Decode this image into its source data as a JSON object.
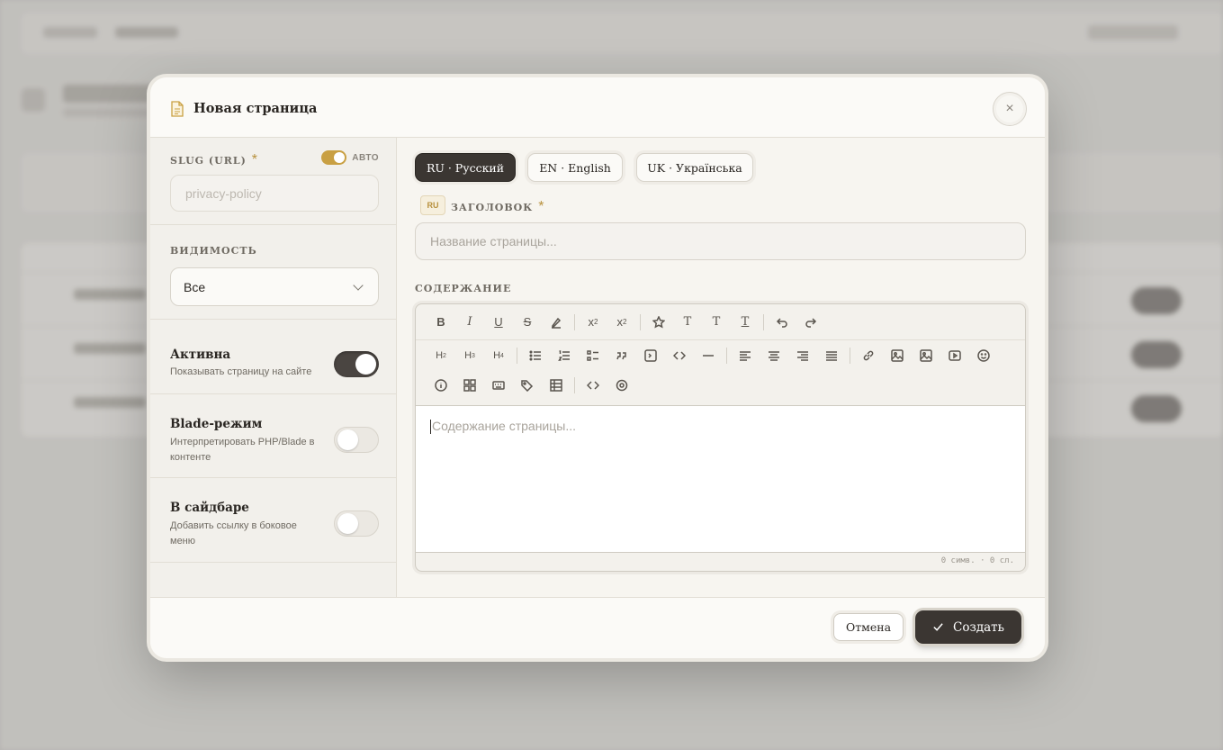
{
  "modal": {
    "title": "Новая страница",
    "close_icon": "×"
  },
  "sidebar": {
    "slug_label": "SLUG (URL)",
    "slug_required": "*",
    "auto_label": "АВТО",
    "slug_placeholder": "privacy-policy",
    "visibility_label": "ВИДИМОСТЬ",
    "visibility_value": "Все",
    "toggles": [
      {
        "title": "Активна",
        "desc": "Показывать страницу на сайте",
        "on": true
      },
      {
        "title": "Blade-режим",
        "desc": "Интерпретировать PHP/Blade в контенте",
        "on": false
      },
      {
        "title": "В сайдбаре",
        "desc": "Добавить ссылку в боковое меню",
        "on": false
      }
    ]
  },
  "main": {
    "lang_tabs": [
      "RU · Русский",
      "EN · English",
      "UK · Українська"
    ],
    "active_lang": "RU · Русский",
    "lang_badge": "RU",
    "title_label": "ЗАГОЛОВОК",
    "title_required": "*",
    "title_placeholder": "Название страницы...",
    "content_label": "СОДЕРЖАНИЕ",
    "editor_placeholder": "Содержание страницы...",
    "editor_stats": "0 симв. · 0 сл."
  },
  "footer": {
    "cancel_label": "Отмена",
    "create_label": "Создать"
  },
  "colors": {
    "accent": "#c9a043",
    "dark": "#3b3632"
  }
}
